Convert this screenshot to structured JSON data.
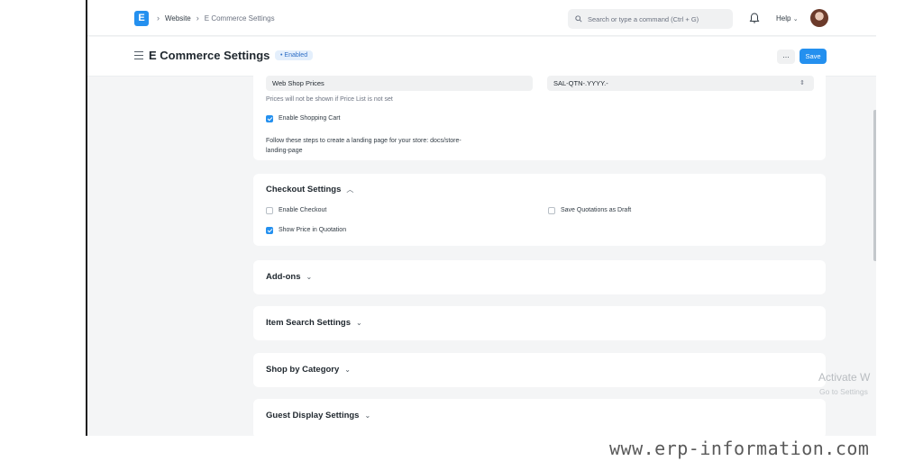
{
  "navbar": {
    "logo_letter": "E",
    "breadcrumb": [
      "Website",
      "E Commerce Settings"
    ],
    "search_placeholder": "Search or type a command (Ctrl + G)",
    "help_label": "Help"
  },
  "page": {
    "title": "E Commerce Settings",
    "status_badge": "• Enabled",
    "more_label": "...",
    "save_label": "Save"
  },
  "top_card": {
    "price_list_value": "Web Shop Prices",
    "quotation_series_value": "SAL-QTN-.YYYY.-",
    "price_list_help": "Prices will not be shown if Price List is not set",
    "enable_shopping_cart_label": "Enable Shopping Cart",
    "enable_shopping_cart_checked": true,
    "landing_text": "Follow these steps to create a landing page for your store: docs/store-",
    "landing_text_2": "landing-page"
  },
  "checkout": {
    "title": "Checkout Settings",
    "enable_checkout_label": "Enable Checkout",
    "show_price_label": "Show Price in Quotation",
    "show_price_checked": true,
    "save_draft_label": "Save Quotations as Draft",
    "save_draft_checked": false
  },
  "sections": [
    {
      "title": "Add-ons"
    },
    {
      "title": "Item Search Settings"
    },
    {
      "title": "Shop by Category"
    },
    {
      "title": "Guest Display Settings"
    }
  ],
  "watermark": {
    "line1": "Activate W",
    "line2": "Go to Settings"
  },
  "site_url": "www.erp-information.com"
}
